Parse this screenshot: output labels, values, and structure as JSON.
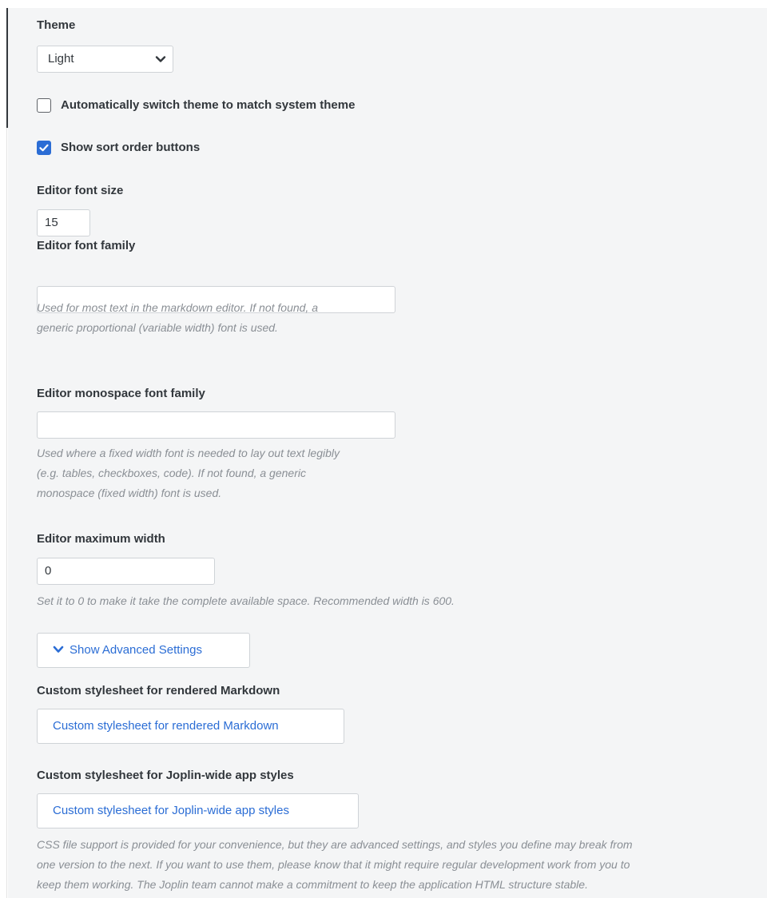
{
  "theme": {
    "label": "Theme",
    "selected": "Light"
  },
  "auto_switch": {
    "label": "Automatically switch theme to match system theme",
    "checked": false
  },
  "sort_buttons": {
    "label": "Show sort order buttons",
    "checked": true
  },
  "editor_font_size": {
    "label": "Editor font size",
    "value": "15"
  },
  "editor_font_family": {
    "label": "Editor font family",
    "value": "",
    "help_line1": "Used for most text in the markdown editor. If not found, a",
    "help_line2": "generic proportional (variable width) font is used."
  },
  "editor_mono_family": {
    "label": "Editor monospace font family",
    "value": "",
    "help_line1": "Used where a fixed width font is needed to lay out text legibly",
    "help_line2": "(e.g. tables, checkboxes, code). If not found, a generic",
    "help_line3": "monospace (fixed width) font is used."
  },
  "editor_max_width": {
    "label": "Editor maximum width",
    "value": "0",
    "help": "Set it to 0 to make it take the complete available space. Recommended width is 600."
  },
  "advanced": {
    "button_label": "Show Advanced Settings",
    "icon": "chevron-down-icon"
  },
  "custom_md_css": {
    "label": "Custom stylesheet for rendered Markdown",
    "button_label": "Custom stylesheet for rendered Markdown"
  },
  "custom_app_css": {
    "label": "Custom stylesheet for Joplin-wide app styles",
    "button_label": "Custom stylesheet for Joplin-wide app styles",
    "help_line1": "CSS file support is provided for your convenience, but they are advanced settings, and styles you define may break from",
    "help_line2": "one version to the next. If you want to use them, please know that it might require regular development work from you to",
    "help_line3": "keep them working. The Joplin team cannot make a commitment to keep the application HTML structure stable."
  },
  "colors": {
    "accent": "#2b6dd5",
    "text": "#32373c",
    "help_text": "#8a8f95",
    "background": "#f4f5f6"
  }
}
